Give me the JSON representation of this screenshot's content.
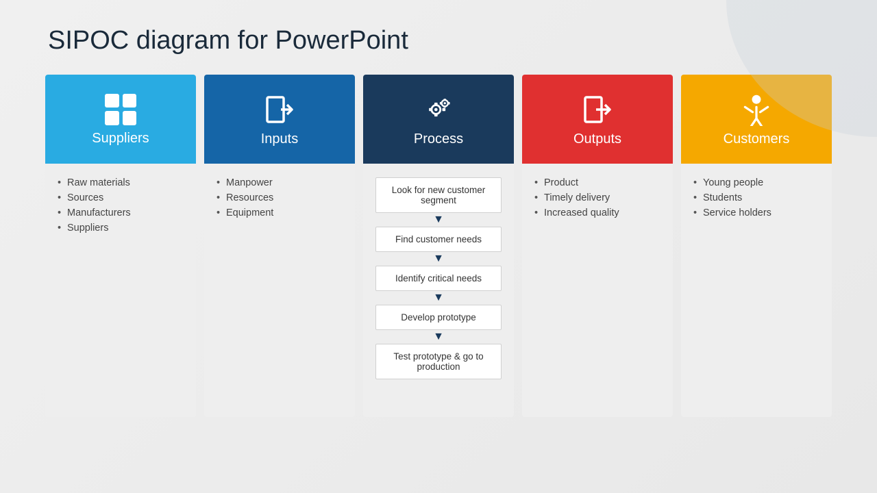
{
  "title": "SIPOC diagram for PowerPoint",
  "columns": [
    {
      "id": "suppliers",
      "label": "Suppliers",
      "icon": "grid",
      "color": "#29ABE2",
      "items": [
        "Raw materials",
        "Sources",
        "Manufacturers",
        "Suppliers"
      ],
      "type": "list"
    },
    {
      "id": "inputs",
      "label": "Inputs",
      "icon": "arrow-in",
      "color": "#1565A7",
      "items": [
        "Manpower",
        "Resources",
        "Equipment"
      ],
      "type": "list"
    },
    {
      "id": "process",
      "label": "Process",
      "icon": "gears",
      "color": "#1A3A5C",
      "steps": [
        "Look for new customer segment",
        "Find customer needs",
        "Identify critical needs",
        "Develop prototype",
        "Test prototype & go to production"
      ],
      "type": "steps"
    },
    {
      "id": "outputs",
      "label": "Outputs",
      "icon": "arrow-out",
      "color": "#E03030",
      "items": [
        "Product",
        "Timely delivery",
        "Increased quality"
      ],
      "type": "list"
    },
    {
      "id": "customers",
      "label": "Customers",
      "icon": "person",
      "color": "#F5A800",
      "items": [
        "Young people",
        "Students",
        "Service holders"
      ],
      "type": "list"
    }
  ]
}
